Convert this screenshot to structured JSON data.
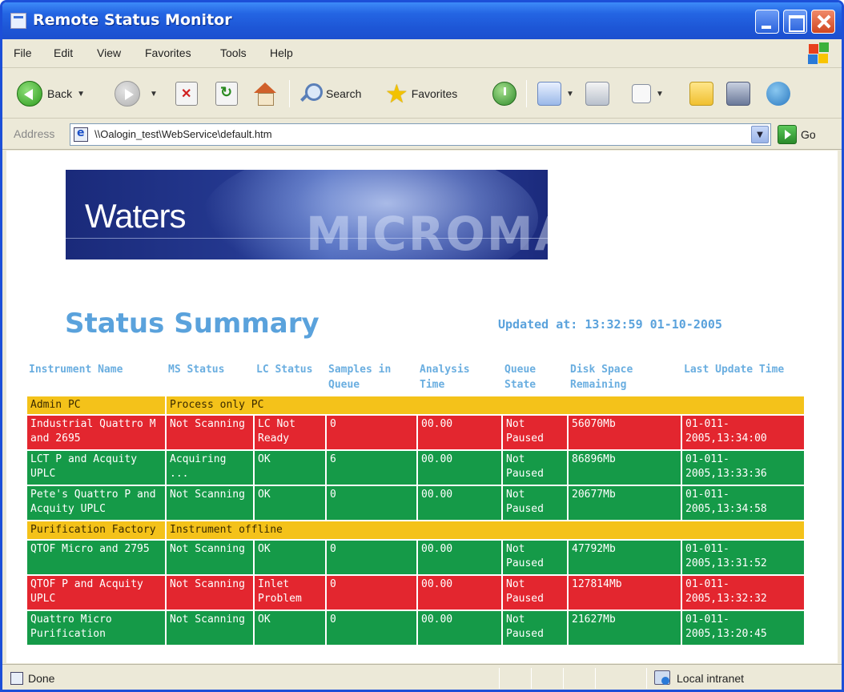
{
  "window": {
    "title": "Remote Status Monitor"
  },
  "menu": [
    "File",
    "Edit",
    "View",
    "Favorites",
    "Tools",
    "Help"
  ],
  "toolbar": {
    "back_label": "Back",
    "search_label": "Search",
    "favorites_label": "Favorites"
  },
  "address": {
    "label": "Address",
    "value": "\\\\Oalogin_test\\WebService\\default.htm",
    "go_label": "Go"
  },
  "banner": {
    "brand": "Waters",
    "watermark": "MICROMASS"
  },
  "page": {
    "title": "Status Summary",
    "updated": "Updated at: 13:32:59 01-10-2005"
  },
  "table": {
    "headers": [
      "Instrument Name",
      "MS Status",
      "LC Status",
      "Samples in Queue",
      "Analysis Time",
      "Queue State",
      "Disk Space Remaining",
      "Last Update Time"
    ],
    "rows": [
      {
        "type": "group",
        "name": "Admin PC",
        "message": "Process only PC"
      },
      {
        "type": "red",
        "cells": [
          "Industrial Quattro M and 2695",
          "Not Scanning",
          "LC Not Ready",
          "0",
          "00.00",
          "Not Paused",
          "56070Mb",
          "01-011-2005,13:34:00"
        ]
      },
      {
        "type": "green",
        "cells": [
          "LCT P and Acquity UPLC",
          "Acquiring ...",
          "OK",
          "6",
          "00.00",
          "Not Paused",
          "86896Mb",
          "01-011-2005,13:33:36"
        ]
      },
      {
        "type": "green",
        "cells": [
          "Pete's Quattro P and Acquity UPLC",
          "Not Scanning",
          "OK",
          "0",
          "00.00",
          "Not Paused",
          "20677Mb",
          "01-011-2005,13:34:58"
        ]
      },
      {
        "type": "group",
        "name": "Purification Factory",
        "message": "Instrument offline"
      },
      {
        "type": "green",
        "cells": [
          "QTOF Micro and 2795",
          "Not Scanning",
          "OK",
          "0",
          "00.00",
          "Not Paused",
          "47792Mb",
          "01-011-2005,13:31:52"
        ]
      },
      {
        "type": "red",
        "cells": [
          "QTOF P and Acquity UPLC",
          "Not Scanning",
          "Inlet Problem",
          "0",
          "00.00",
          "Not Paused",
          "127814Mb",
          "01-011-2005,13:32:32"
        ]
      },
      {
        "type": "green",
        "cells": [
          "Quattro Micro Purification",
          "Not Scanning",
          "OK",
          "0",
          "00.00",
          "Not Paused",
          "21627Mb",
          "01-011-2005,13:20:45"
        ]
      }
    ]
  },
  "statusbar": {
    "left": "Done",
    "zone": "Local intranet"
  },
  "colors": {
    "group": "#f4c21a",
    "error": "#e3262f",
    "ok": "#159a48",
    "heading": "#5aa2dc",
    "titlebar": "#2465e3"
  },
  "icons": [
    "ie-page-icon",
    "back-arrow-icon",
    "forward-arrow-icon",
    "stop-icon",
    "refresh-icon",
    "home-icon",
    "search-icon",
    "favorites-star-icon",
    "history-icon",
    "mail-icon",
    "print-icon",
    "edit-icon",
    "folder-icon",
    "research-icon",
    "messenger-icon",
    "go-arrow-icon",
    "windows-logo-icon",
    "intranet-zone-icon"
  ]
}
